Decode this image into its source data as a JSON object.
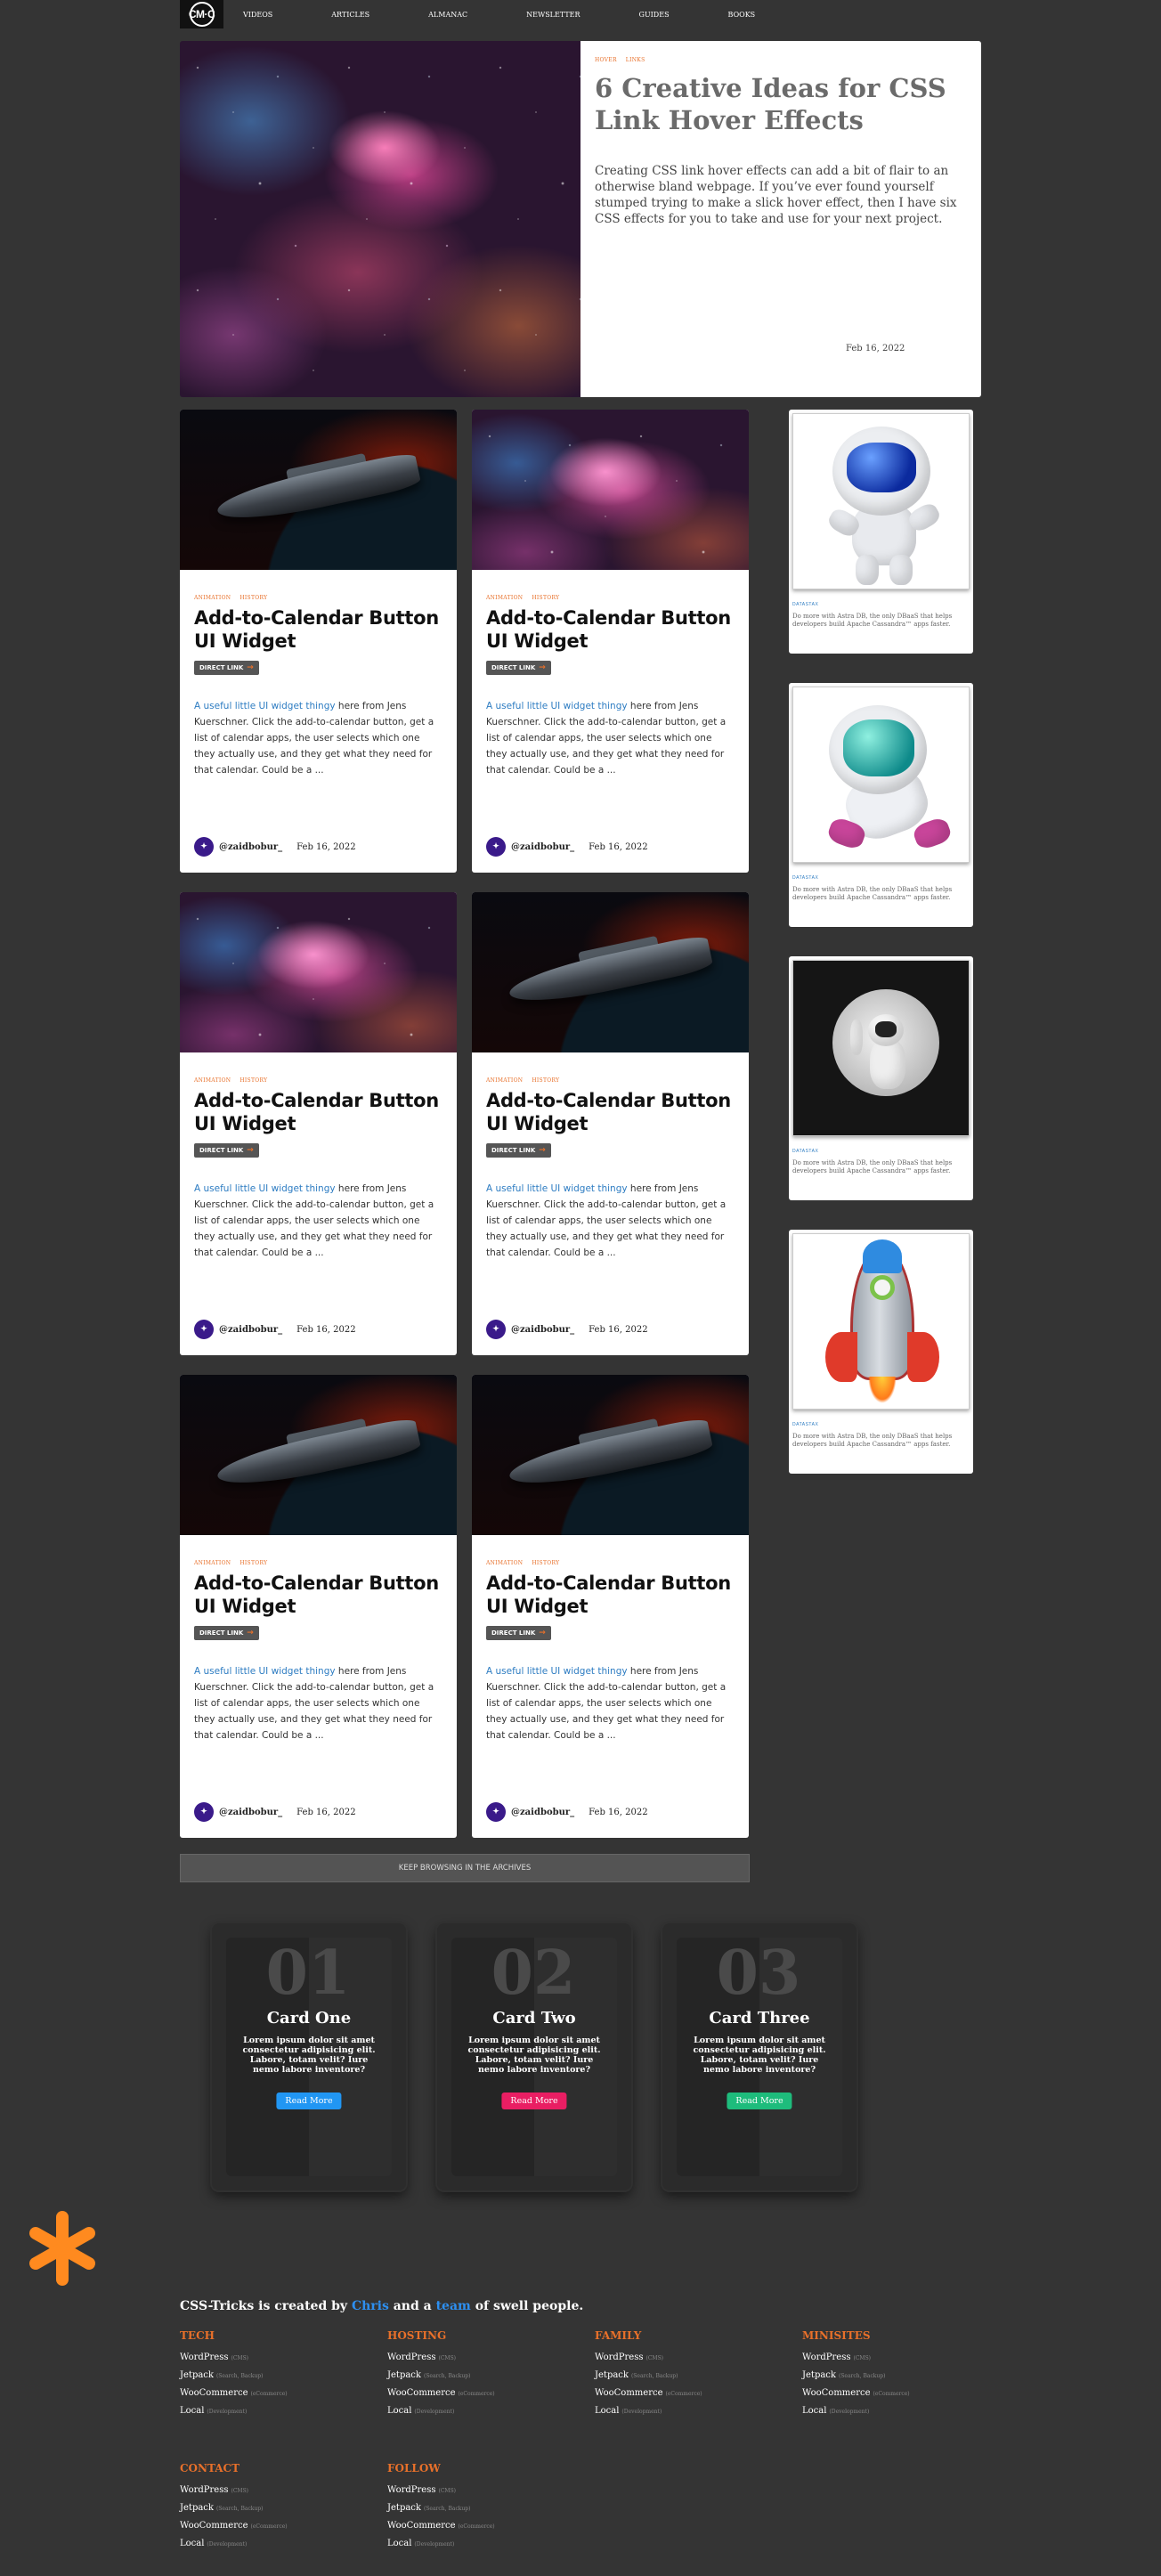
{
  "nav": {
    "logo": "CM·C",
    "links": [
      "VIDEOS",
      "ARTICLES",
      "ALMANAC",
      "NEWSLETTER",
      "GUIDES",
      "BOOKS"
    ]
  },
  "hero": {
    "tags": [
      "HOVER",
      "LINKS"
    ],
    "title": "6 Creative Ideas for CSS Link Hover Effects",
    "description": "Creating CSS link hover effects can add a bit of flair to an otherwise bland webpage. If you’ve ever found yourself stumped trying to make a slick hover effect, then I have six CSS effects for you to take and use for your next project.",
    "date": "Feb 16, 2022"
  },
  "cards": [
    {
      "image": "spaceship",
      "tags": [
        "ANIMATION",
        "HISTORY"
      ],
      "title": "Add-to-Calendar Button UI Widget",
      "direct": "DIRECT LINK",
      "excerpt_link": "A useful little UI widget thingy",
      "excerpt": " here from Jens Kuerschner. Click the add-to-calendar button, get a list of calendar apps, the user selects which one they actually use, and they get what they need for that calendar. Could be a ...",
      "author": "@zaidbobur_",
      "date": "Feb 16, 2022"
    },
    {
      "image": "nebula",
      "tags": [
        "ANIMATION",
        "HISTORY"
      ],
      "title": "Add-to-Calendar Button UI Widget",
      "direct": "DIRECT LINK",
      "excerpt_link": "A useful little UI widget thingy",
      "excerpt": " here from Jens Kuerschner. Click the add-to-calendar button, get a list of calendar apps, the user selects which one they actually use, and they get what they need for that calendar. Could be a ...",
      "author": "@zaidbobur_",
      "date": "Feb 16, 2022"
    },
    {
      "image": "nebula",
      "tags": [
        "ANIMATION",
        "HISTORY"
      ],
      "title": "Add-to-Calendar Button UI Widget",
      "direct": "DIRECT LINK",
      "excerpt_link": "A useful little UI widget thingy",
      "excerpt": " here from Jens Kuerschner. Click the add-to-calendar button, get a list of calendar apps, the user selects which one they actually use, and they get what they need for that calendar. Could be a ...",
      "author": "@zaidbobur_",
      "date": "Feb 16, 2022"
    },
    {
      "image": "spaceship",
      "tags": [
        "ANIMATION",
        "HISTORY"
      ],
      "title": "Add-to-Calendar Button UI Widget",
      "direct": "DIRECT LINK",
      "excerpt_link": "A useful little UI widget thingy",
      "excerpt": " here from Jens Kuerschner. Click the add-to-calendar button, get a list of calendar apps, the user selects which one they actually use, and they get what they need for that calendar. Could be a ...",
      "author": "@zaidbobur_",
      "date": "Feb 16, 2022"
    },
    {
      "image": "spaceship",
      "tags": [
        "ANIMATION",
        "HISTORY"
      ],
      "title": "Add-to-Calendar Button UI Widget",
      "direct": "DIRECT LINK",
      "excerpt_link": "A useful little UI widget thingy",
      "excerpt": " here from Jens Kuerschner. Click the add-to-calendar button, get a list of calendar apps, the user selects which one they actually use, and they get what they need for that calendar. Could be a ...",
      "author": "@zaidbobur_",
      "date": "Feb 16, 2022"
    },
    {
      "image": "spaceship",
      "tags": [
        "ANIMATION",
        "HISTORY"
      ],
      "title": "Add-to-Calendar Button UI Widget",
      "direct": "DIRECT LINK",
      "excerpt_link": "A useful little UI widget thingy",
      "excerpt": " here from Jens Kuerschner. Click the add-to-calendar button, get a list of calendar apps, the user selects which one they actually use, and they get what they need for that calendar. Could be a ...",
      "author": "@zaidbobur_",
      "date": "Feb 16, 2022"
    }
  ],
  "archive_label": "KEEP BROWSING IN THE ARCHIVES",
  "ads": [
    {
      "image": "astronaut-balloon",
      "tag": "DATASTAX",
      "text": "Do more with Astra DB, the only DBaaS that helps developers build Apache Cassandra™ apps faster."
    },
    {
      "image": "astronaut-floating",
      "tag": "DATASTAX",
      "text": "Do more with Astra DB, the only DBaaS that helps developers build Apache Cassandra™ apps faster."
    },
    {
      "image": "astronaut-moon",
      "tag": "DATASTAX",
      "text": "Do more with Astra DB, the only DBaaS that helps developers build Apache Cassandra™ apps faster."
    },
    {
      "image": "rocket-balloon",
      "tag": "DATASTAX",
      "text": "Do more with Astra DB, the only DBaaS that helps developers build Apache Cassandra™ apps faster."
    }
  ],
  "feature_cards": [
    {
      "number": "01",
      "name": "Card One",
      "text": "Lorem ipsum dolor sit amet consectetur adipisicing elit. Labore, totam velit? Iure nemo labore inventore?",
      "button": "Read More",
      "color": "#2196f3"
    },
    {
      "number": "02",
      "name": "Card Two",
      "text": "Lorem ipsum dolor sit amet consectetur adipisicing elit. Labore, totam velit? Iure nemo labore inventore?",
      "button": "Read More",
      "color": "#e91e63"
    },
    {
      "number": "03",
      "name": "Card Three",
      "text": "Lorem ipsum dolor sit amet consectetur adipisicing elit. Labore, totam velit? Iure nemo labore inventore?",
      "button": "Read More",
      "color": "#1ebc7c"
    }
  ],
  "footer": {
    "credit": {
      "pre": "CSS-Tricks is created by ",
      "chris": "Chris",
      "mid": " and a ",
      "team": "team",
      "post": " of swell people."
    },
    "columns": [
      {
        "title": "TECH",
        "items": [
          {
            "label": "WordPress",
            "sub": "(CMS)"
          },
          {
            "label": "Jetpack",
            "sub": "(Search, Backup)"
          },
          {
            "label": "WooCommerce",
            "sub": "(eCommerce)"
          },
          {
            "label": "Local",
            "sub": "(Development)"
          }
        ]
      },
      {
        "title": "HOSTING",
        "items": [
          {
            "label": "WordPress",
            "sub": "(CMS)"
          },
          {
            "label": "Jetpack",
            "sub": "(Search, Backup)"
          },
          {
            "label": "WooCommerce",
            "sub": "(eCommerce)"
          },
          {
            "label": "Local",
            "sub": "(Development)"
          }
        ]
      },
      {
        "title": "FAMILY",
        "items": [
          {
            "label": "WordPress",
            "sub": "(CMS)"
          },
          {
            "label": "Jetpack",
            "sub": "(Search, Backup)"
          },
          {
            "label": "WooCommerce",
            "sub": "(eCommerce)"
          },
          {
            "label": "Local",
            "sub": "(Development)"
          }
        ]
      },
      {
        "title": "MINISITES",
        "items": [
          {
            "label": "WordPress",
            "sub": "(CMS)"
          },
          {
            "label": "Jetpack",
            "sub": "(Search, Backup)"
          },
          {
            "label": "WooCommerce",
            "sub": "(eCommerce)"
          },
          {
            "label": "Local",
            "sub": "(Development)"
          }
        ]
      },
      {
        "title": "CONTACT",
        "items": [
          {
            "label": "WordPress",
            "sub": "(CMS)"
          },
          {
            "label": "Jetpack",
            "sub": "(Search, Backup)"
          },
          {
            "label": "WooCommerce",
            "sub": "(eCommerce)"
          },
          {
            "label": "Local",
            "sub": "(Development)"
          }
        ]
      },
      {
        "title": "FOLLOW",
        "items": [
          {
            "label": "WordPress",
            "sub": "(CMS)"
          },
          {
            "label": "Jetpack",
            "sub": "(Search, Backup)"
          },
          {
            "label": "WooCommerce",
            "sub": "(eCommerce)"
          },
          {
            "label": "Local",
            "sub": "(Development)"
          }
        ]
      }
    ]
  },
  "colors": {
    "accent": "#e8702a",
    "link": "#2d7cc2",
    "background": "#343434"
  }
}
